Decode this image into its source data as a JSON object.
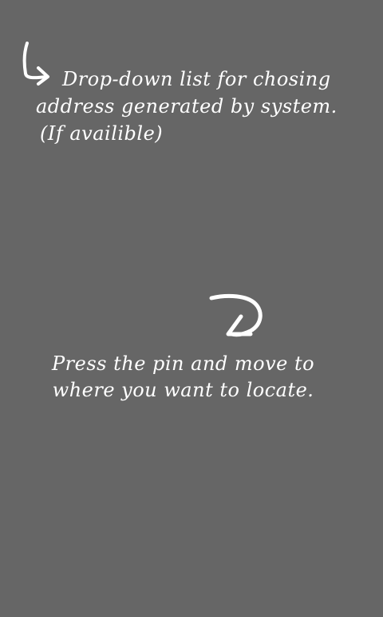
{
  "overlay": {
    "background_color": "#666666",
    "text_color": "#ffffff"
  },
  "hints": {
    "dropdown": {
      "arrow_icon": "curved-arrow-down-right-icon",
      "lines": [
        "Drop-down list for chosing",
        "address generated by system.",
        "(If availible)"
      ]
    },
    "pin": {
      "arrow_icon": "curved-arrow-down-left-icon",
      "lines": [
        "Press the pin and move to",
        "where you want to locate."
      ]
    }
  }
}
